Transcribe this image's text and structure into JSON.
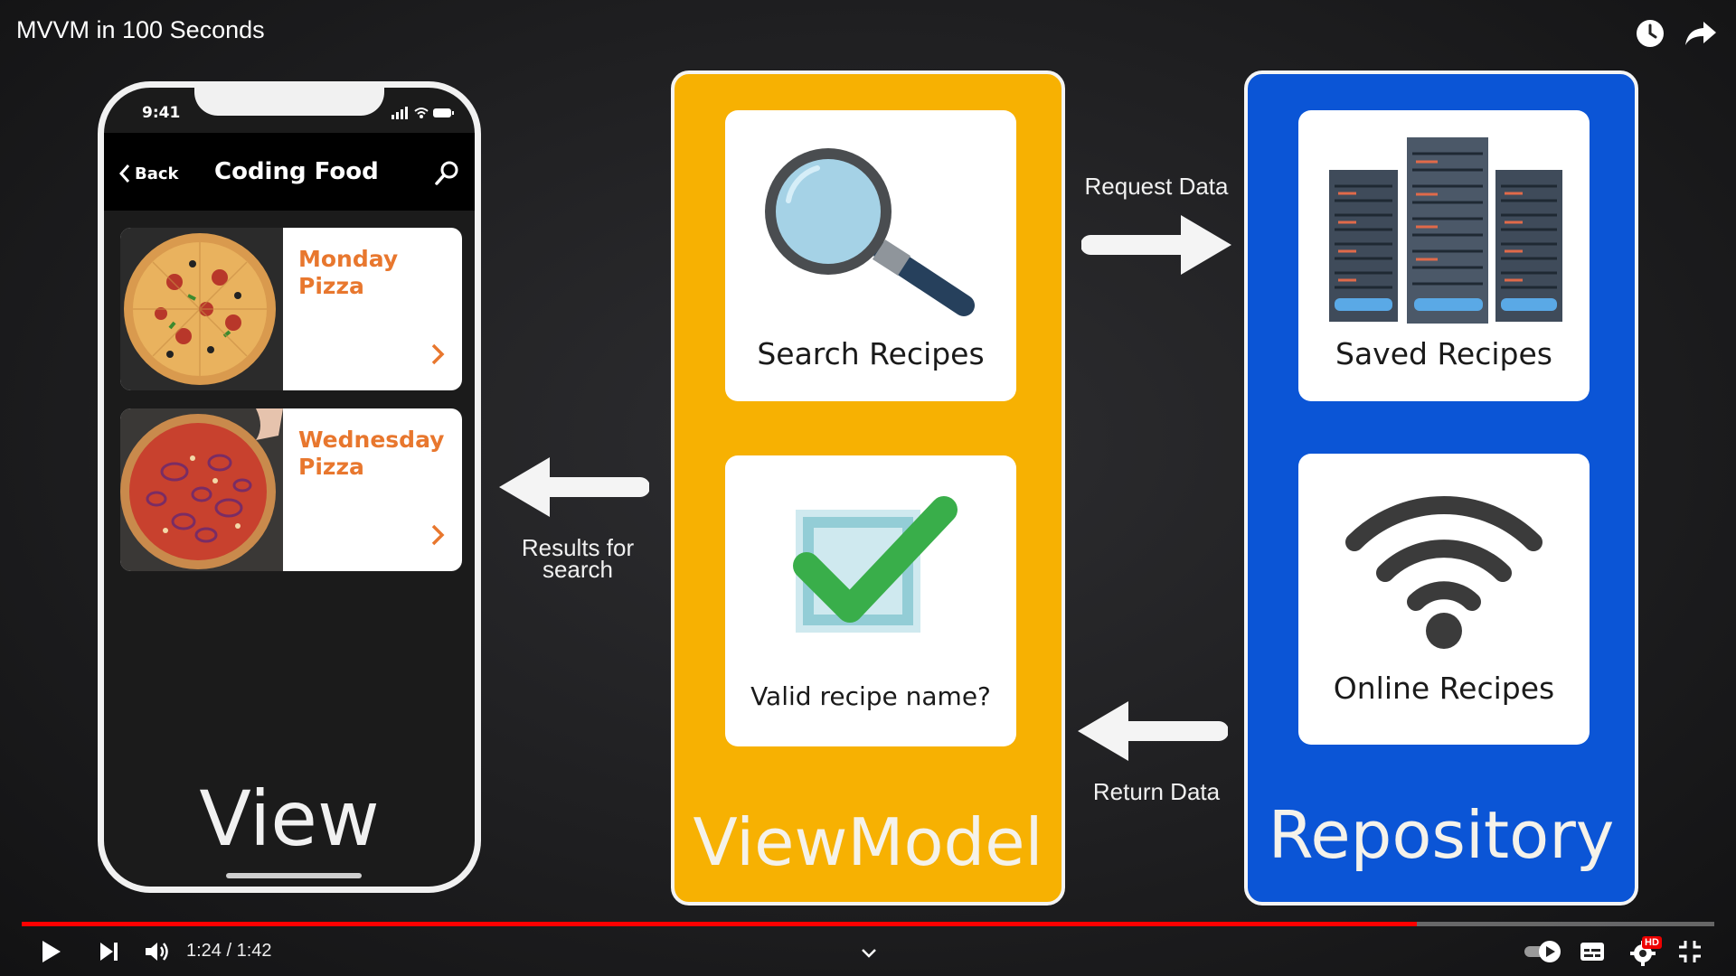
{
  "header": {
    "title": "MVVM in 100 Seconds",
    "watch_later_icon": "clock-icon",
    "share_icon": "share-arrow-icon"
  },
  "phone": {
    "status_time": "9:41",
    "back_label": "Back",
    "title": "Coding Food",
    "search_icon": "search-icon",
    "recipes": [
      {
        "name": "Monday Pizza",
        "image": "pizza-image"
      },
      {
        "name": "Wednesday Pizza",
        "image": "pizza-image"
      }
    ],
    "label": "View"
  },
  "viewmodel": {
    "title": "ViewModel",
    "search_card": "Search Recipes",
    "validate_card": "Valid recipe name?",
    "color": "#f7b102"
  },
  "repository": {
    "title": "Repository",
    "saved_card": "Saved Recipes",
    "online_card": "Online Recipes",
    "color": "#0b55d6"
  },
  "arrows": {
    "request": "Request Data",
    "return": "Return Data",
    "results": "Results for search"
  },
  "player": {
    "time": "1:24 / 1:42",
    "progress": 0.824,
    "accent": "#ff0000",
    "controls": [
      "play-icon",
      "next-icon",
      "volume-icon",
      "chevron-down-icon",
      "autoplay-toggle",
      "subtitles-icon",
      "settings-icon",
      "exit-fullscreen-icon"
    ],
    "settings_badge": "HD"
  }
}
